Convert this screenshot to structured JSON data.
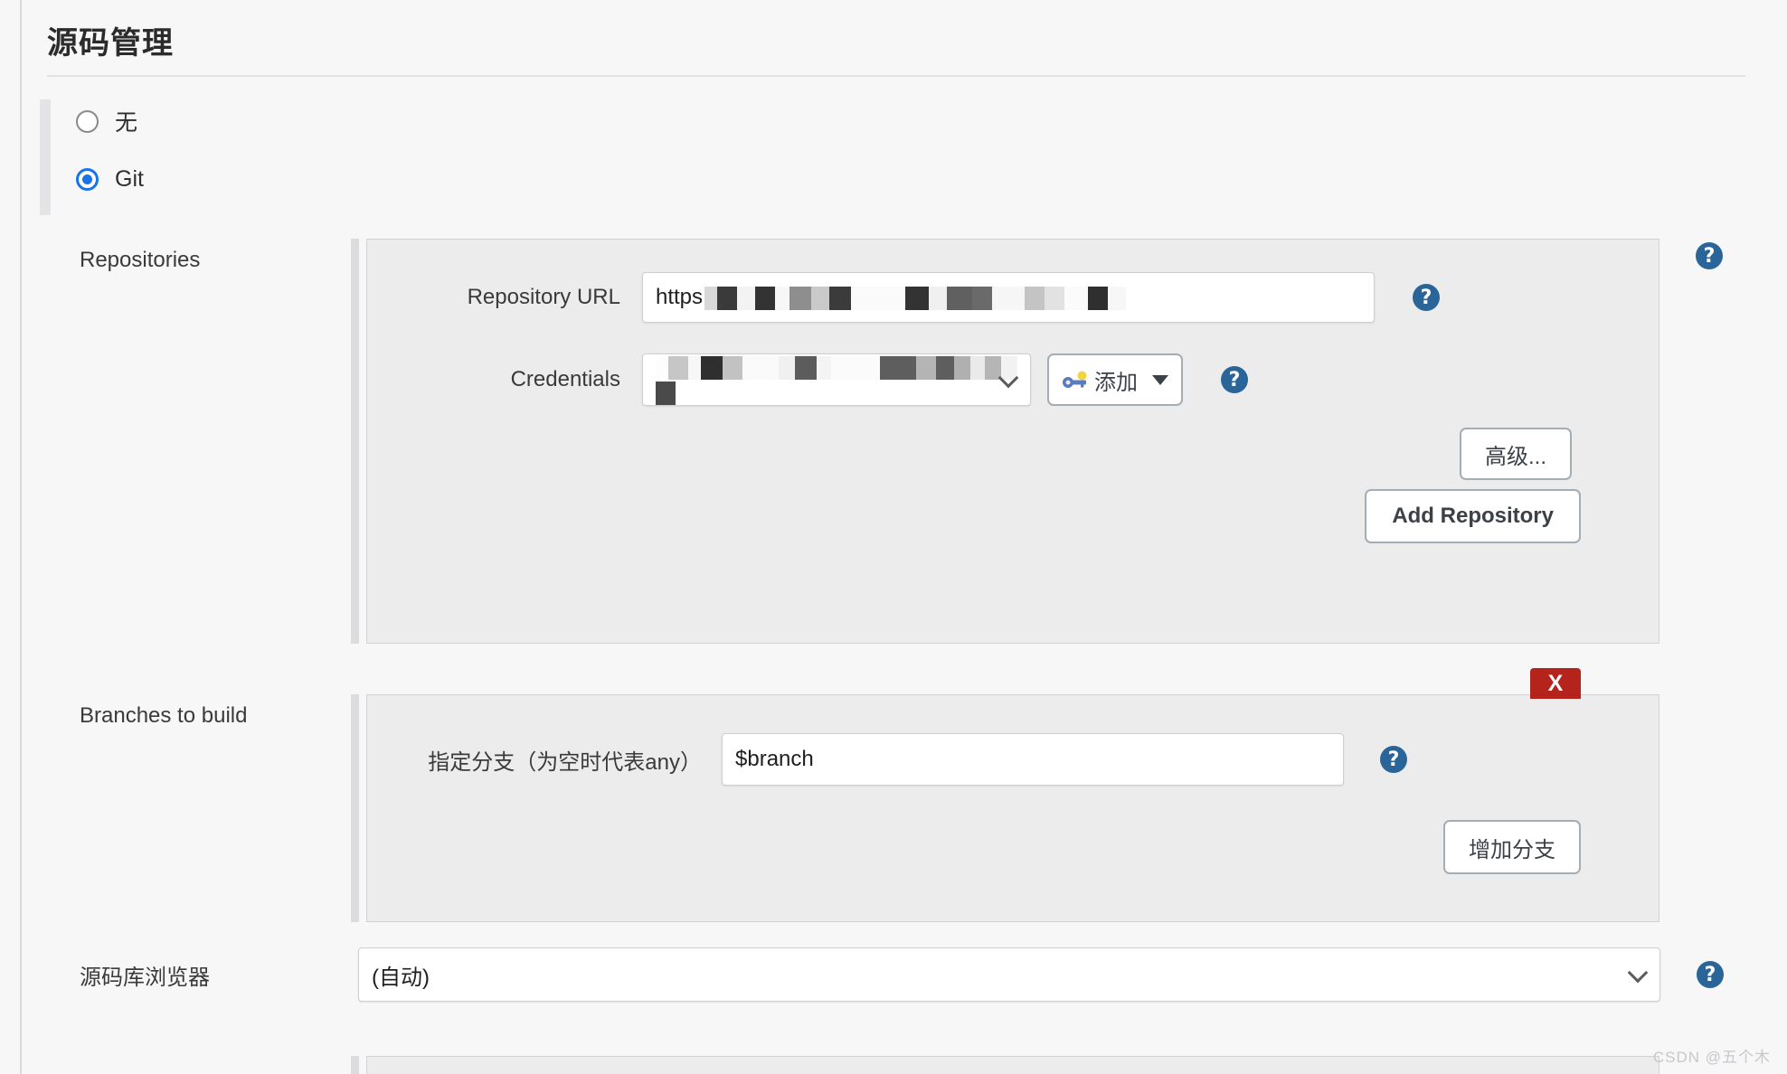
{
  "page": {
    "title": "源码管理",
    "watermark": "CSDN @五个木"
  },
  "scm_options": [
    {
      "label": "无",
      "selected": false
    },
    {
      "label": "Git",
      "selected": true
    }
  ],
  "repositories": {
    "section_label": "Repositories",
    "repository_url": {
      "label": "Repository URL",
      "value_visible_prefix": "https",
      "redacted": true
    },
    "credentials": {
      "label": "Credentials",
      "value_visible": "",
      "redacted": true
    },
    "add_credentials_button": "添加",
    "advanced_button": "高级...",
    "add_repository_button": "Add Repository"
  },
  "branches": {
    "section_label": "Branches to build",
    "branch_specifier": {
      "label": "指定分支（为空时代表any）",
      "value": "$branch"
    },
    "delete_button": "X",
    "add_branch_button": "增加分支"
  },
  "repo_browser": {
    "label": "源码库浏览器",
    "value": "(自动)"
  },
  "help_icon_glyph": "?",
  "colors": {
    "accent_radio": "#1874e8",
    "help_blue": "#2a6599",
    "delete_red": "#b5231d",
    "panel_bg": "#ececec",
    "page_bg": "#f7f7f8"
  }
}
